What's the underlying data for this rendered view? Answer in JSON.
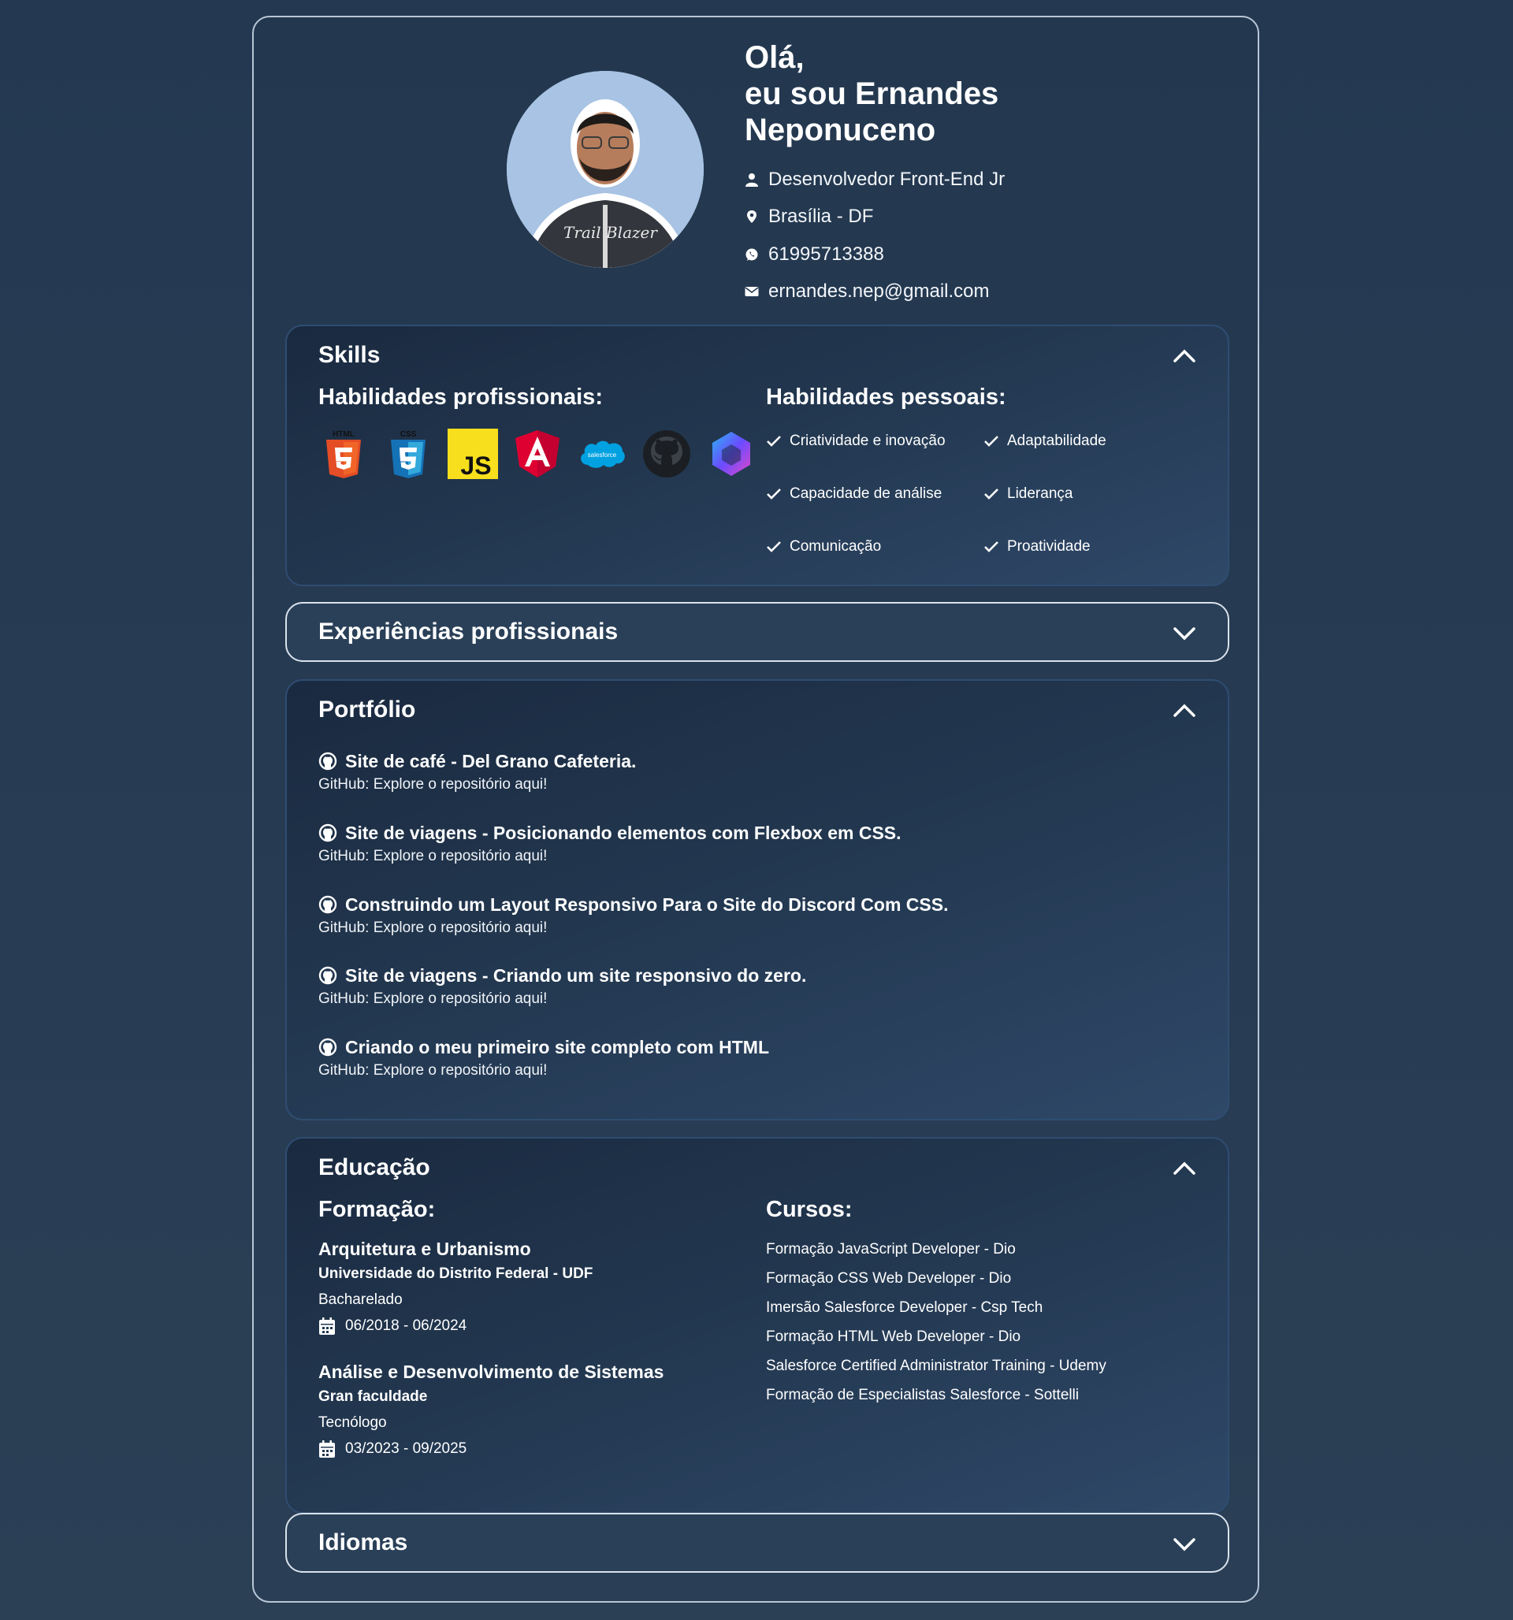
{
  "header": {
    "greeting_line1": "Olá,",
    "greeting_line2": "eu sou Ernandes",
    "greeting_line3": "Neponuceno",
    "role": "Desenvolvedor Front-End Jr",
    "location": "Brasília - DF",
    "phone": "61995713388",
    "email": "ernandes.nep@gmail.com",
    "photo_caption": "Trail Blazer"
  },
  "skills": {
    "title": "Skills",
    "professional_heading": "Habilidades profissionais:",
    "personal_heading": "Habilidades pessoais:",
    "professional_icons": [
      "html5-icon",
      "css3-icon",
      "javascript-icon",
      "angular-icon",
      "salesforce-icon",
      "github-icon",
      "copilot-icon"
    ],
    "icon_text": {
      "html": "HTML",
      "css": "CSS",
      "js": "JS",
      "salesforce": "salesforce"
    },
    "personal": [
      "Criatividade e inovação",
      "Adaptabilidade",
      "Capacidade de análise",
      "Liderança",
      "Comunicação",
      "Proatividade"
    ]
  },
  "experience": {
    "title": "Experiências profissionais"
  },
  "portfolio": {
    "title": "Portfólio",
    "items": [
      {
        "title": "Site de café - Del Grano Cafeteria.",
        "link": "GitHub: Explore o repositório aqui!"
      },
      {
        "title": "Site de viagens - Posicionando elementos com Flexbox em CSS.",
        "link": "GitHub: Explore o repositório aqui!"
      },
      {
        "title": "Construindo um Layout Responsivo Para o Site do Discord Com CSS.",
        "link": "GitHub: Explore o repositório aqui!"
      },
      {
        "title": "Site de viagens - Criando um site responsivo do zero.",
        "link": "GitHub: Explore o repositório aqui!"
      },
      {
        "title": "Criando o meu primeiro site completo com HTML",
        "link": "GitHub: Explore o repositório aqui!"
      }
    ]
  },
  "education": {
    "title": "Educação",
    "formation_heading": "Formação:",
    "courses_heading": "Cursos:",
    "degrees": [
      {
        "name": "Arquitetura e Urbanismo",
        "institution": "Universidade do Distrito Federal - UDF",
        "level": "Bacharelado",
        "dates": "06/2018 - 06/2024"
      },
      {
        "name": "Análise e Desenvolvimento de Sistemas",
        "institution": "Gran faculdade",
        "level": "Tecnólogo",
        "dates": "03/2023 - 09/2025"
      }
    ],
    "courses": [
      "Formação JavaScript Developer - Dio",
      "Formação CSS Web Developer - Dio",
      "Imersão Salesforce Developer - Csp Tech",
      "Formação HTML Web Developer - Dio",
      "Salesforce Certified Administrator Training - Udemy",
      "Formação de Especialistas Salesforce - Sottelli"
    ]
  },
  "languages": {
    "title": "Idiomas"
  },
  "colors": {
    "background": "#243951",
    "panel_border": "#2f4d72",
    "text": "#ffffff"
  }
}
